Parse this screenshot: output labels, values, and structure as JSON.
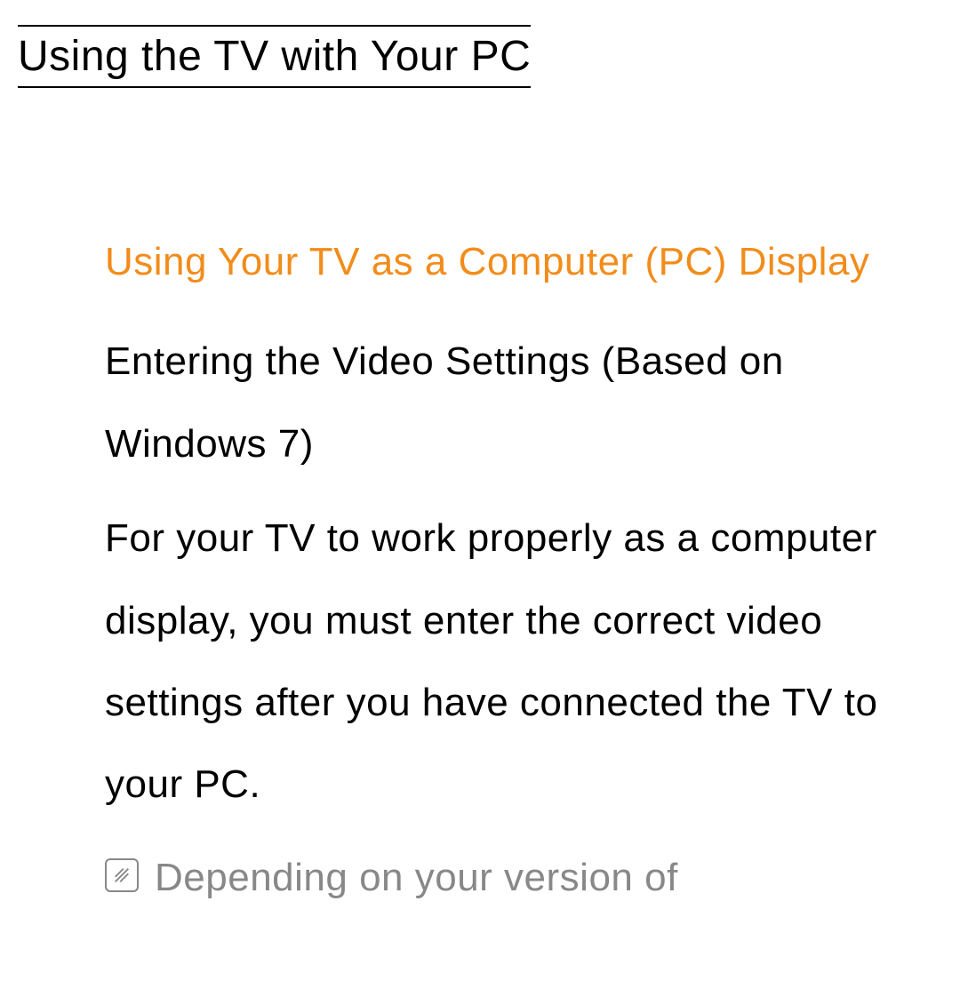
{
  "page": {
    "title": "Using the TV with Your PC"
  },
  "content": {
    "section_heading": "Using Your TV as a Computer (PC) Display",
    "subsection": "Entering the Video Settings (Based on Windows 7)",
    "body_text": "For your TV to work properly as a computer display, you must enter the correct video settings after you have connected the TV to your PC.",
    "note_text": "Depending on your version of"
  }
}
